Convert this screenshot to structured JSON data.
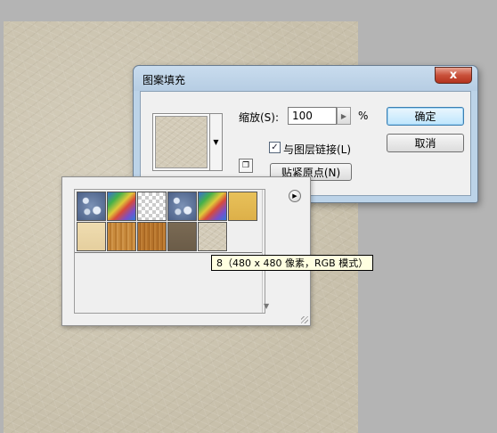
{
  "dialog": {
    "title": "图案填充",
    "close_label": "x",
    "scale_label": "缩放(S):",
    "scale_value": "100",
    "scale_unit": "%",
    "link_label": "与图层链接(L)",
    "link_checked": true,
    "snap_label": "贴紧原点(N)",
    "ok_label": "确定",
    "cancel_label": "取消"
  },
  "picker": {
    "patterns": [
      {
        "name": "bubbles"
      },
      {
        "name": "tie-dye"
      },
      {
        "name": "transparent"
      },
      {
        "name": "bubbles"
      },
      {
        "name": "tie-dye"
      },
      {
        "name": "yellow"
      },
      {
        "name": "cream"
      },
      {
        "name": "wood-light"
      },
      {
        "name": "wood-dark"
      },
      {
        "name": "brown"
      },
      {
        "name": "paper"
      }
    ],
    "selected_index": 10,
    "tooltip": "8（480 x 480 像素，RGB 模式）"
  },
  "colors": {
    "canvas": "#cfc7b3",
    "dialog_frame": "#bcd3e8",
    "close_button": "#c9503a",
    "ok_button": "#bee6fd"
  }
}
